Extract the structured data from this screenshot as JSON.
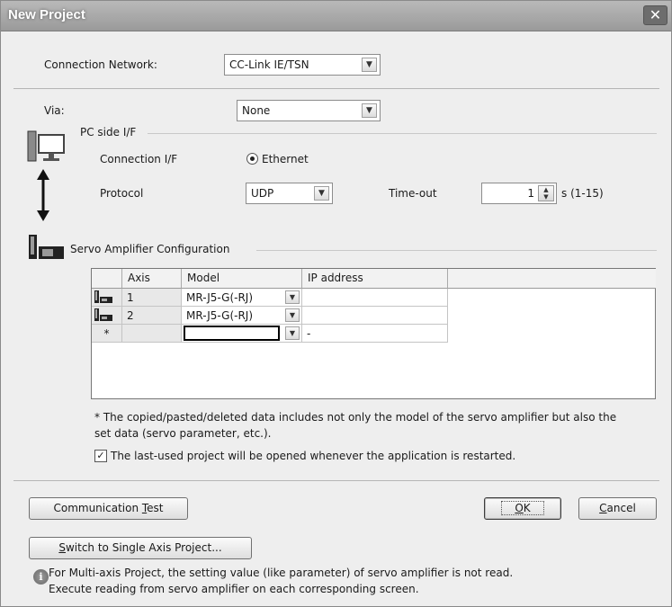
{
  "window": {
    "title": "New Project",
    "close": "✕"
  },
  "connection_network": {
    "label": "Connection Network:",
    "value": "CC-Link IE/TSN"
  },
  "via": {
    "label": "Via:",
    "value": "None"
  },
  "pc_side": {
    "title": "PC side I/F",
    "connection_if_label": "Connection I/F",
    "connection_if_option": "Ethernet",
    "protocol_label": "Protocol",
    "protocol_value": "UDP",
    "timeout_label": "Time-out",
    "timeout_value": "1",
    "timeout_unit": "s (1-15)"
  },
  "servo_config": {
    "title": "Servo Amplifier Configuration",
    "columns": [
      "Axis",
      "Model",
      "IP address"
    ],
    "rows": [
      {
        "axis": "1",
        "model": "MR-J5-G(-RJ)",
        "ip": ""
      },
      {
        "axis": "2",
        "model": "MR-J5-G(-RJ)",
        "ip": ""
      },
      {
        "marker": "*",
        "axis": "",
        "model": "",
        "ip": "-"
      }
    ],
    "note": "* The copied/pasted/deleted data includes not only the model of the servo amplifier but also the",
    "note2": "set data (servo parameter, etc.).",
    "reopen_checkbox_label": "The last-used project will be opened whenever the application is restarted.",
    "reopen_checked": true
  },
  "buttons": {
    "comm_test_pre": "Communication ",
    "comm_test_key": "T",
    "comm_test_post": "est",
    "ok_key": "O",
    "ok_post": "K",
    "cancel_key": "C",
    "cancel_post": "ancel",
    "switch_key": "S",
    "switch_post": "witch to Single Axis Project..."
  },
  "info": {
    "line1": "For Multi-axis Project, the setting value (like parameter) of servo amplifier is not read.",
    "line2": "Execute reading from servo amplifier on each corresponding screen."
  }
}
